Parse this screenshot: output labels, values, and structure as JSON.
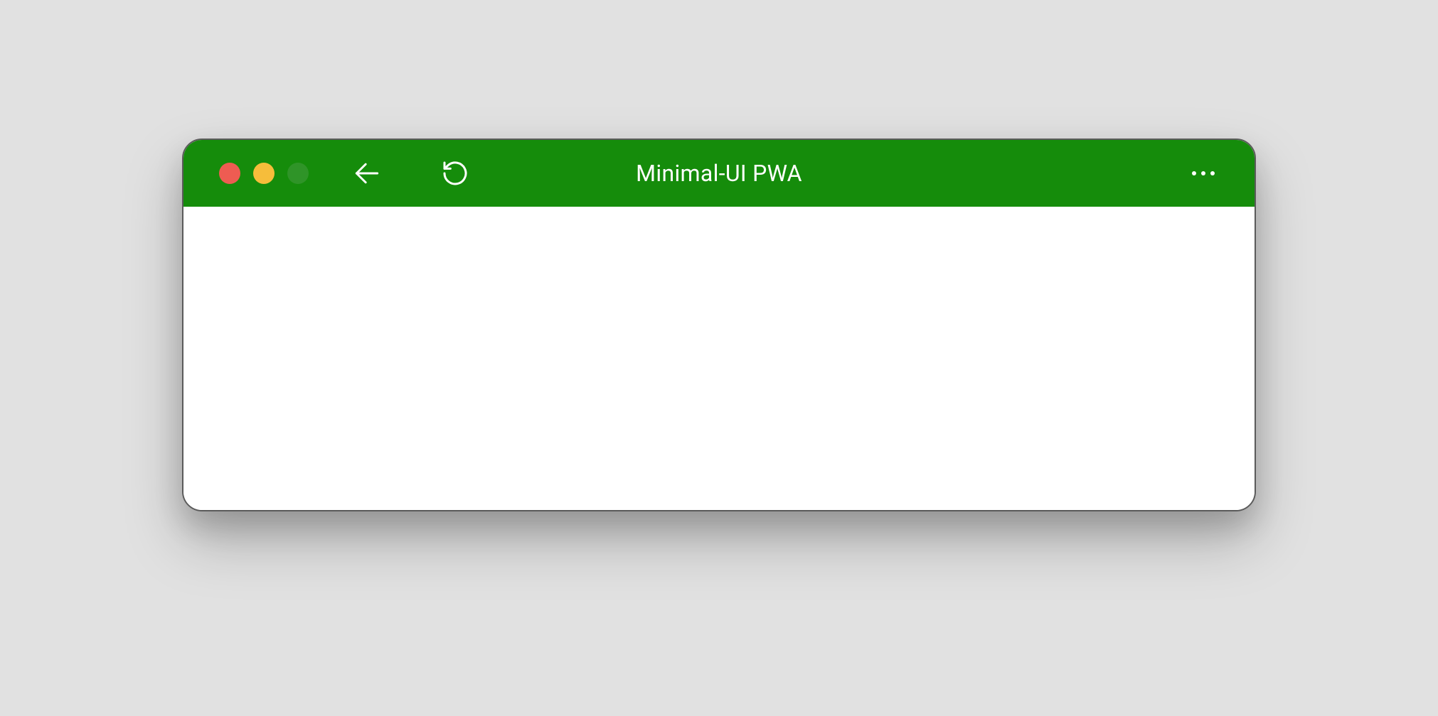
{
  "window": {
    "title": "Minimal-UI PWA",
    "colors": {
      "titlebar_bg": "#158c0b",
      "titlebar_fg": "#ffffff",
      "content_bg": "#ffffff",
      "page_bg": "#e1e1e1",
      "close": "#ee5c52",
      "minimize": "#f6bd3b",
      "zoom": "#2f9428"
    }
  }
}
